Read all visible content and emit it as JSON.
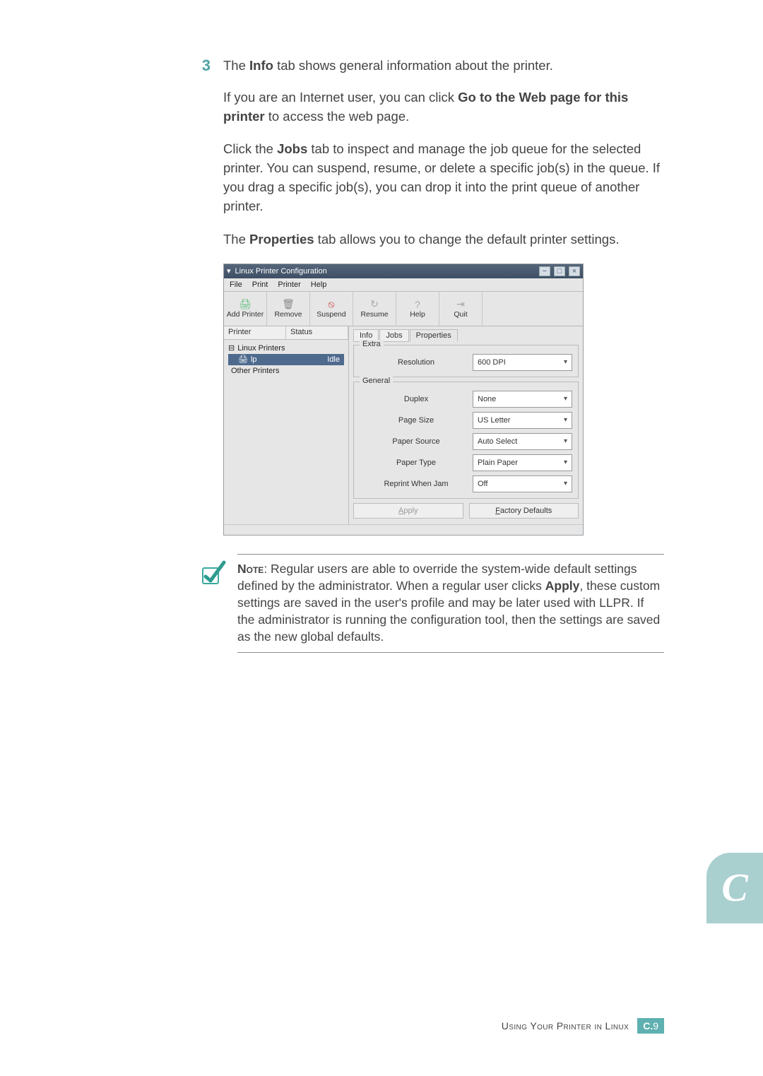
{
  "step": {
    "number": "3",
    "text_prefix": "The ",
    "info_word": "Info",
    "text_suffix": " tab shows general information about the printer."
  },
  "para1": {
    "prefix": "If you are an Internet user, you can click ",
    "bold": "Go to the Web page for this printer",
    "suffix": " to access the web page."
  },
  "para2": {
    "prefix": "Click the ",
    "bold": "Jobs",
    "suffix": " tab to inspect and manage the job queue for the selected printer. You can suspend, resume, or delete a specific job(s) in the queue. If you drag a specific job(s), you can drop it into the print queue of another printer."
  },
  "para3": {
    "prefix": "The ",
    "bold": "Properties",
    "suffix": " tab allows you to change the default printer settings."
  },
  "note": {
    "label": "Note",
    "t1": ": Regular users are able to override the system-wide default settings defined by the administrator. When a regular user clicks ",
    "apply": "Apply",
    "t2": ", these custom settings are saved in the user's profile and may be later used with LLPR. If the administrator is running the configuration tool, then the settings are saved as the new global defaults."
  },
  "side_tab": "C",
  "footer": {
    "text": "Using Your Printer in Linux",
    "page_letter": "C.",
    "page_num": "9"
  },
  "shot": {
    "title": "Linux Printer Configuration",
    "menus": [
      "File",
      "Print",
      "Printer",
      "Help"
    ],
    "toolbar": {
      "add_printer": "Add Printer",
      "remove": "Remove",
      "suspend": "Suspend",
      "resume": "Resume",
      "help": "Help",
      "quit": "Quit"
    },
    "left": {
      "headers": {
        "printer": "Printer",
        "status": "Status"
      },
      "linux_printers": "Linux Printers",
      "lp_name": "lp",
      "lp_status": "Idle",
      "other_printers": "Other Printers"
    },
    "tabs": {
      "info": "Info",
      "jobs": "Jobs",
      "properties": "Properties"
    },
    "groups": {
      "extra": {
        "title": "Extra",
        "resolution_label": "Resolution",
        "resolution_value": "600 DPI"
      },
      "general": {
        "title": "General",
        "duplex": {
          "label": "Duplex",
          "value": "None"
        },
        "page_size": {
          "label": "Page Size",
          "value": "US Letter"
        },
        "paper_source": {
          "label": "Paper Source",
          "value": "Auto Select"
        },
        "paper_type": {
          "label": "Paper Type",
          "value": "Plain Paper"
        },
        "reprint": {
          "label": "Reprint When Jam",
          "value": "Off"
        }
      }
    },
    "buttons": {
      "apply": "Apply",
      "factory_defaults": "Factory Defaults"
    }
  }
}
